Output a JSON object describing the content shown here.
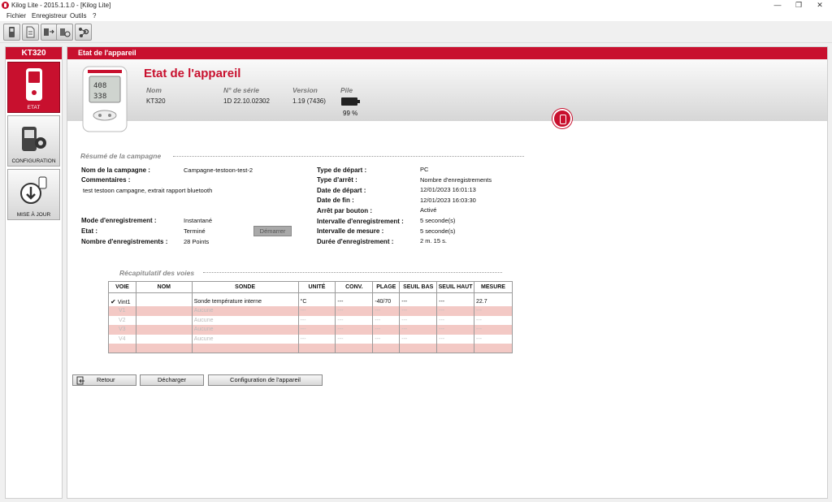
{
  "window": {
    "title": "Kilog Lite - 2015.1.1.0 - [Kilog Lite]",
    "controls": {
      "minimize": "—",
      "maximize": "❐",
      "close": "✕"
    }
  },
  "menu": [
    "Fichier",
    "Enregistreur",
    "Outils",
    "?"
  ],
  "toolbar": {
    "buttons": [
      "device-icon",
      "document-icon",
      "transfer-icon",
      "settings-network-icon"
    ]
  },
  "sidebar": {
    "device_name": "KT320",
    "items": [
      {
        "label": "ETAT",
        "icon": "device-icon",
        "active": true
      },
      {
        "label": "CONFIGURATION",
        "icon": "device-config-icon",
        "active": false
      },
      {
        "label": "MISE À JOUR",
        "icon": "download-update-icon",
        "active": false
      }
    ]
  },
  "main": {
    "header": "Etat de l'appareil",
    "title": "Etat de l'appareil",
    "device_info": {
      "headers": {
        "name": "Nom",
        "serial": "N° de série",
        "version": "Version",
        "battery": "Pile"
      },
      "values": {
        "name": "KT320",
        "serial": "1D 22.10.02302",
        "version": "1.19 (7436)",
        "battery_pct": "99 %"
      },
      "battery_level": 0.99
    }
  },
  "campaign": {
    "section_title": "Résumé de la campagne",
    "left": {
      "name_label": "Nom de la campagne :",
      "name_value": "Campagne-testoon-test-2",
      "comments_label": "Commentaires :",
      "comments_value": "test testoon campagne, extrait rapport bluetooth",
      "mode_label": "Mode d'enregistrement :",
      "mode_value": "Instantané",
      "state_label": "Etat :",
      "state_value": "Terminé",
      "count_label": "Nombre d'enregistrements :",
      "count_value": "28 Points",
      "start_button": "Démarrer"
    },
    "right": {
      "labels": [
        "Type de départ :",
        "Type d'arrêt :",
        "Date de départ :",
        "Date de fin :",
        "Arrêt par bouton :",
        "Intervalle d'enregistrement :",
        "Intervalle de mesure :",
        "Durée d'enregistrement :"
      ],
      "values": [
        "PC",
        "Nombre d'enregistrements",
        "12/01/2023 16:01:13",
        "12/01/2023 16:03:30",
        "Activé",
        "5 seconde(s)",
        "5 seconde(s)",
        "2 m. 15 s."
      ]
    }
  },
  "channels": {
    "section_title": "Récapitulatif des voies",
    "headers": [
      "VOIE",
      "NOM",
      "SONDE",
      "UNITÉ",
      "CONV.",
      "PLAGE",
      "SEUIL BAS",
      "SEUIL HAUT",
      "MESURE"
    ],
    "rows": [
      [
        "Vint1",
        "",
        "Sonde température interne",
        "°C",
        "---",
        "-40/70",
        "---",
        "---",
        "22.7"
      ],
      [
        "V1",
        "",
        "Aucune",
        "---",
        "---",
        "---",
        "---",
        "---",
        "---"
      ],
      [
        "V2",
        "",
        "Aucune",
        "---",
        "---",
        "---",
        "---",
        "---",
        "---"
      ],
      [
        "V3",
        "",
        "Aucune",
        "---",
        "---",
        "---",
        "---",
        "---",
        "---"
      ],
      [
        "V4",
        "",
        "Aucune",
        "---",
        "---",
        "---",
        "---",
        "---",
        "---"
      ],
      [
        "",
        "",
        "",
        "",
        "",
        "",
        "",
        "",
        ""
      ]
    ]
  },
  "actions": {
    "back": "Retour",
    "download": "Décharger",
    "configure": "Configuration de l'appareil"
  },
  "colors": {
    "accent": "#c8102e",
    "alt_row": "#f3c9c5"
  }
}
